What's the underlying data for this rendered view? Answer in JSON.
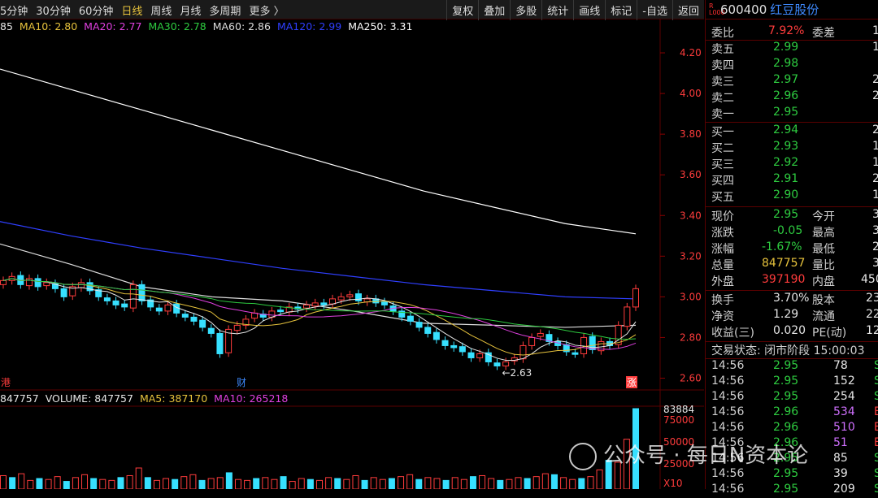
{
  "toolbar": {
    "periods": [
      "5分钟",
      "30分钟",
      "60分钟",
      "日线",
      "周线",
      "月线",
      "多周期",
      "更多 〉"
    ],
    "active_period": "日线",
    "tools": [
      "复权",
      "叠加",
      "多股",
      "统计",
      "画线",
      "标记",
      "-自选",
      "返回"
    ]
  },
  "ma_legend": [
    {
      "label": "85",
      "color": "#e6e6e6"
    },
    {
      "label": "MA10: 2.80",
      "color": "#e6c23c"
    },
    {
      "label": "MA20: 2.77",
      "color": "#e040e0"
    },
    {
      "label": "MA30: 2.78",
      "color": "#2ecc40"
    },
    {
      "label": "MA60: 2.86",
      "color": "#dddddd"
    },
    {
      "label": "MA120: 2.99",
      "color": "#2f3fff"
    },
    {
      "label": "MA250: 3.31",
      "color": "#ffffff"
    }
  ],
  "price_axis": [
    "4.20",
    "4.00",
    "3.80",
    "3.60",
    "3.40",
    "3.20",
    "3.00",
    "2.80",
    "2.60"
  ],
  "low_marker": "2.63",
  "event_marks": [
    "港",
    "财",
    "涨"
  ],
  "volume_legend": [
    {
      "label": "847757",
      "color": "#e6e6e6"
    },
    {
      "label": "VOLUME: 847757",
      "color": "#e6e6e6"
    },
    {
      "label": "MA5: 387170",
      "color": "#e6c23c"
    },
    {
      "label": "MA10: 265218",
      "color": "#e040e0"
    }
  ],
  "volume_axis": [
    "83884",
    "75000",
    "50000",
    "25000",
    "X10"
  ],
  "stock": {
    "badge": "R\nL000",
    "code": "600400",
    "name": "红豆股份"
  },
  "order_book": {
    "webi_label": "委比",
    "webi_value": "7.92%",
    "wecha_label": "委差",
    "wecha_value": "1",
    "asks": [
      {
        "label": "卖五",
        "price": "2.99",
        "vol": "1"
      },
      {
        "label": "卖四",
        "price": "2.98",
        "vol": ""
      },
      {
        "label": "卖三",
        "price": "2.97",
        "vol": "2"
      },
      {
        "label": "卖二",
        "price": "2.96",
        "vol": "2"
      },
      {
        "label": "卖一",
        "price": "2.95",
        "vol": ""
      }
    ],
    "bids": [
      {
        "label": "买一",
        "price": "2.94",
        "vol": "2"
      },
      {
        "label": "买二",
        "price": "2.93",
        "vol": "1"
      },
      {
        "label": "买三",
        "price": "2.92",
        "vol": "1"
      },
      {
        "label": "买四",
        "price": "2.91",
        "vol": "2"
      },
      {
        "label": "买五",
        "price": "2.90",
        "vol": "1"
      }
    ]
  },
  "quote": [
    {
      "l1": "现价",
      "v1": "2.95",
      "c1": "green",
      "l2": "今开",
      "v2": "3"
    },
    {
      "l1": "涨跌",
      "v1": "-0.05",
      "c1": "green",
      "l2": "最高",
      "v2": "3"
    },
    {
      "l1": "涨幅",
      "v1": "-1.67%",
      "c1": "green",
      "l2": "最低",
      "v2": "2"
    },
    {
      "l1": "总量",
      "v1": "847757",
      "c1": "yellow",
      "l2": "量比",
      "v2": "3"
    },
    {
      "l1": "外盘",
      "v1": "397190",
      "c1": "red",
      "l2": "内盘",
      "v2": "450"
    }
  ],
  "stats": [
    {
      "l1": "换手",
      "v1": "3.70%",
      "l2": "股本",
      "v2": "23"
    },
    {
      "l1": "净资",
      "v1": "1.29",
      "l2": "流通",
      "v2": "22"
    },
    {
      "l1": "收益(三)",
      "v1": "0.020",
      "l2": "PE(动)",
      "v2": "12"
    }
  ],
  "trade_status": "交易状态: 闭市阶段 15:00:03",
  "ticks": [
    {
      "time": "14:56",
      "price": "2.95",
      "vol": "78",
      "side": "S"
    },
    {
      "time": "14:56",
      "price": "2.95",
      "vol": "152",
      "side": "S"
    },
    {
      "time": "14:56",
      "price": "2.95",
      "vol": "254",
      "side": "S"
    },
    {
      "time": "14:56",
      "price": "2.96",
      "vol": "534",
      "side": "B"
    },
    {
      "time": "14:56",
      "price": "2.96",
      "vol": "510",
      "side": "B"
    },
    {
      "time": "14:56",
      "price": "2.96",
      "vol": "51",
      "side": "B"
    },
    {
      "time": "14:56",
      "price": "2.95",
      "vol": "85",
      "side": "S"
    },
    {
      "time": "14:56",
      "price": "2.95",
      "vol": "39",
      "side": "S"
    },
    {
      "time": "14:56",
      "price": "2.95",
      "vol": "209",
      "side": "S"
    }
  ],
  "watermark": "公众号 · 每日N资本论",
  "chart_data": {
    "type": "candlestick",
    "ylim": [
      2.55,
      4.3
    ],
    "y_ticks": [
      4.2,
      4.0,
      3.8,
      3.6,
      3.4,
      3.2,
      3.0,
      2.8,
      2.6
    ],
    "closes": [
      3.08,
      3.1,
      3.06,
      3.09,
      3.05,
      3.07,
      3.04,
      3.0,
      3.05,
      3.07,
      3.03,
      3.0,
      2.98,
      2.96,
      2.95,
      3.06,
      2.98,
      2.95,
      2.93,
      2.96,
      2.92,
      2.9,
      2.88,
      2.85,
      2.82,
      2.72,
      2.84,
      2.86,
      2.89,
      2.92,
      2.9,
      2.93,
      2.93,
      2.95,
      2.94,
      2.96,
      2.97,
      2.96,
      2.99,
      3.0,
      3.01,
      2.98,
      2.99,
      2.97,
      2.96,
      2.93,
      2.9,
      2.88,
      2.85,
      2.82,
      2.79,
      2.76,
      2.75,
      2.73,
      2.7,
      2.72,
      2.68,
      2.66,
      2.68,
      2.7,
      2.76,
      2.8,
      2.82,
      2.78,
      2.76,
      2.73,
      2.72,
      2.8,
      2.74,
      2.78,
      2.76,
      2.86,
      2.95,
      3.04
    ],
    "ma_series": [
      {
        "name": "MA250",
        "color": "#ffffff",
        "values": [
          4.12,
          4.02,
          3.92,
          3.82,
          3.72,
          3.62,
          3.52,
          3.44,
          3.36,
          3.31
        ]
      },
      {
        "name": "MA120",
        "color": "#2f3fff",
        "values": [
          3.37,
          3.3,
          3.24,
          3.19,
          3.14,
          3.1,
          3.06,
          3.03,
          3.0,
          2.99
        ]
      },
      {
        "name": "MA60",
        "color": "#dddddd",
        "values": [
          3.26,
          3.16,
          3.05,
          3.0,
          2.98,
          2.93,
          2.87,
          2.86,
          2.85,
          2.86
        ]
      }
    ],
    "volume_max": 83884,
    "volumes": [
      14000,
      12000,
      16000,
      9000,
      11000,
      10000,
      13000,
      8000,
      12000,
      15000,
      11000,
      10000,
      9000,
      12000,
      14000,
      22000,
      12000,
      9000,
      11000,
      10000,
      13000,
      15000,
      9000,
      11000,
      12000,
      17000,
      10000,
      9000,
      11000,
      12000,
      10000,
      13000,
      8000,
      11000,
      10000,
      9000,
      12000,
      11000,
      10000,
      14000,
      9000,
      12000,
      10000,
      11000,
      13000,
      15000,
      10000,
      12000,
      11000,
      9000,
      12000,
      10000,
      13000,
      14000,
      11000,
      9000,
      10000,
      12000,
      11000,
      13000,
      16000,
      15000,
      12000,
      10000,
      11000,
      13000,
      20000,
      30000,
      28000,
      52000,
      83884
    ]
  }
}
